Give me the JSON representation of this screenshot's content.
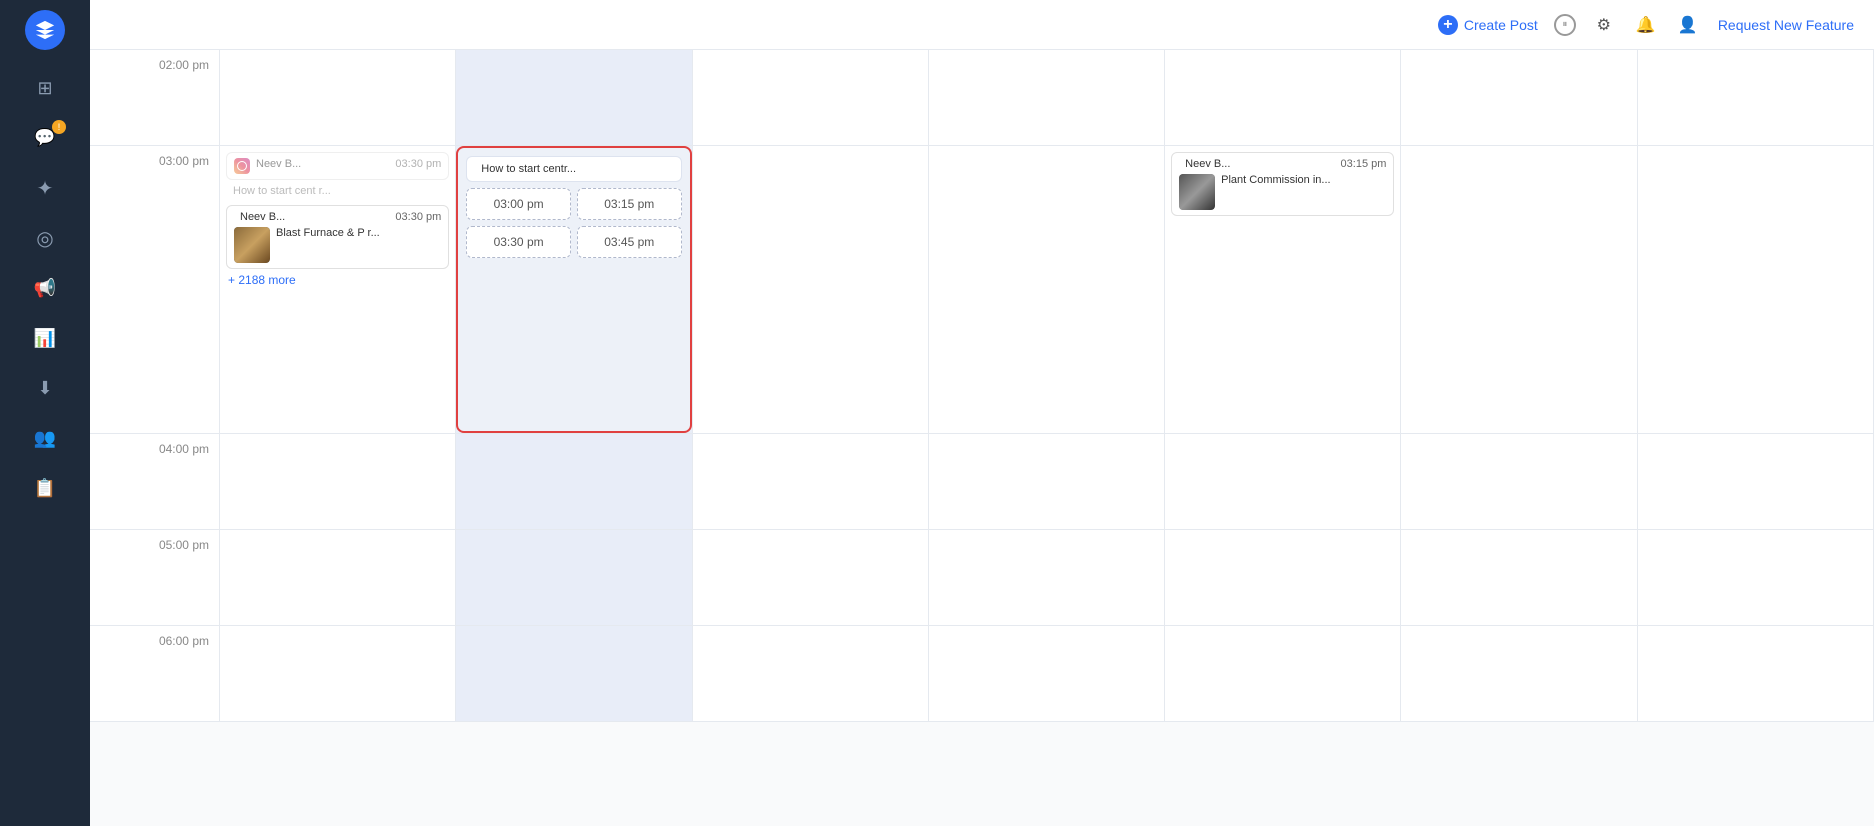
{
  "sidebar": {
    "logo_title": "Navigation",
    "items": [
      {
        "id": "dashboard",
        "icon": "⊞",
        "label": "Dashboard",
        "active": false
      },
      {
        "id": "posts",
        "icon": "💬",
        "label": "Posts",
        "active": true,
        "badge": "!"
      },
      {
        "id": "network",
        "icon": "✦",
        "label": "Network",
        "active": false
      },
      {
        "id": "targeting",
        "icon": "◎",
        "label": "Targeting",
        "active": false
      },
      {
        "id": "campaigns",
        "icon": "📢",
        "label": "Campaigns",
        "active": false
      },
      {
        "id": "analytics",
        "icon": "📊",
        "label": "Analytics",
        "active": false
      },
      {
        "id": "export",
        "icon": "⬇",
        "label": "Export",
        "active": false
      },
      {
        "id": "team",
        "icon": "👥",
        "label": "Team",
        "active": false
      },
      {
        "id": "reports",
        "icon": "📋",
        "label": "Reports",
        "active": false
      }
    ]
  },
  "topbar": {
    "create_label": "Create Post",
    "request_feature_label": "Request New Feature"
  },
  "calendar": {
    "time_slots": [
      {
        "label": "02:00 pm",
        "hour": 14
      },
      {
        "label": "03:00 pm",
        "hour": 15
      },
      {
        "label": "04:00 pm",
        "hour": 16
      },
      {
        "label": "05:00 pm",
        "hour": 17
      },
      {
        "label": "06:00 pm",
        "hour": 18
      }
    ],
    "events": {
      "col1_row2_event1": {
        "platform_icon": "instagram",
        "account": "Neev B...",
        "time": "03:30 pm",
        "title": "How to start cent r...",
        "has_thumb": true,
        "faded": true
      },
      "col1_row2_event2": {
        "platform_icon": "instagram",
        "account": "Neev B...",
        "time": "03:30 pm",
        "title": "Blast Furnace & P r...",
        "has_thumb": true
      },
      "col1_more": "+ 2188 more",
      "popup_event": {
        "platform_icon": "instagram",
        "title": "How to start centr...",
        "times": [
          "03:00 pm",
          "03:15 pm",
          "03:30 pm",
          "03:45 pm"
        ]
      },
      "col5_event": {
        "platform_icon": "instagram",
        "account": "Neev B...",
        "time": "03:15 pm",
        "title": "Plant Commission in..."
      }
    }
  }
}
